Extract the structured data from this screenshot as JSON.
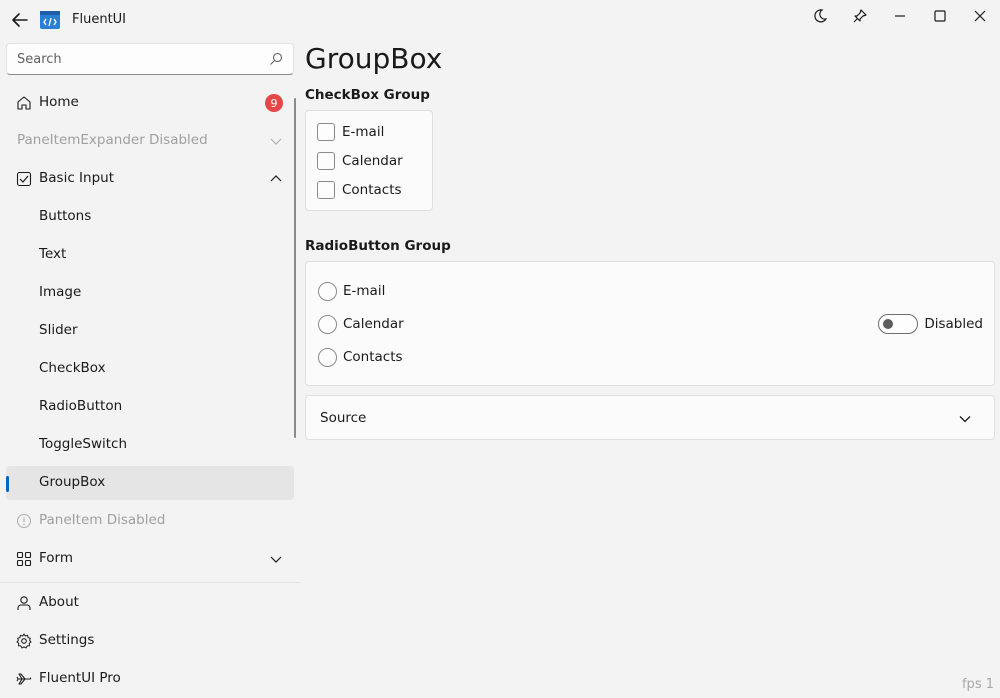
{
  "app": {
    "title": "FluentUI"
  },
  "search": {
    "placeholder": "Search"
  },
  "nav": {
    "home": {
      "label": "Home",
      "badge": "9"
    },
    "pane_expander_disabled": {
      "label": "PaneItemExpander Disabled"
    },
    "basic_input": {
      "label": "Basic Input"
    },
    "children": [
      "Buttons",
      "Text",
      "Image",
      "Slider",
      "CheckBox",
      "RadioButton",
      "ToggleSwitch",
      "GroupBox"
    ],
    "pane_item_disabled": {
      "label": "PaneItem Disabled"
    },
    "form": {
      "label": "Form"
    },
    "about": {
      "label": "About"
    },
    "settings": {
      "label": "Settings"
    },
    "pro": {
      "label": "FluentUI Pro"
    },
    "selected": "GroupBox"
  },
  "page": {
    "title": "GroupBox",
    "checkbox_group": {
      "label": "CheckBox Group",
      "items": [
        "E-mail",
        "Calendar",
        "Contacts"
      ]
    },
    "radio_group": {
      "label": "RadioButton Group",
      "items": [
        "E-mail",
        "Calendar",
        "Contacts"
      ],
      "toggle_label": "Disabled"
    },
    "source": {
      "label": "Source"
    }
  },
  "footer": {
    "fps": "fps 1"
  },
  "colors": {
    "accent": "#0067c0",
    "badge": "#e64646",
    "background": "#f3f3f3"
  }
}
